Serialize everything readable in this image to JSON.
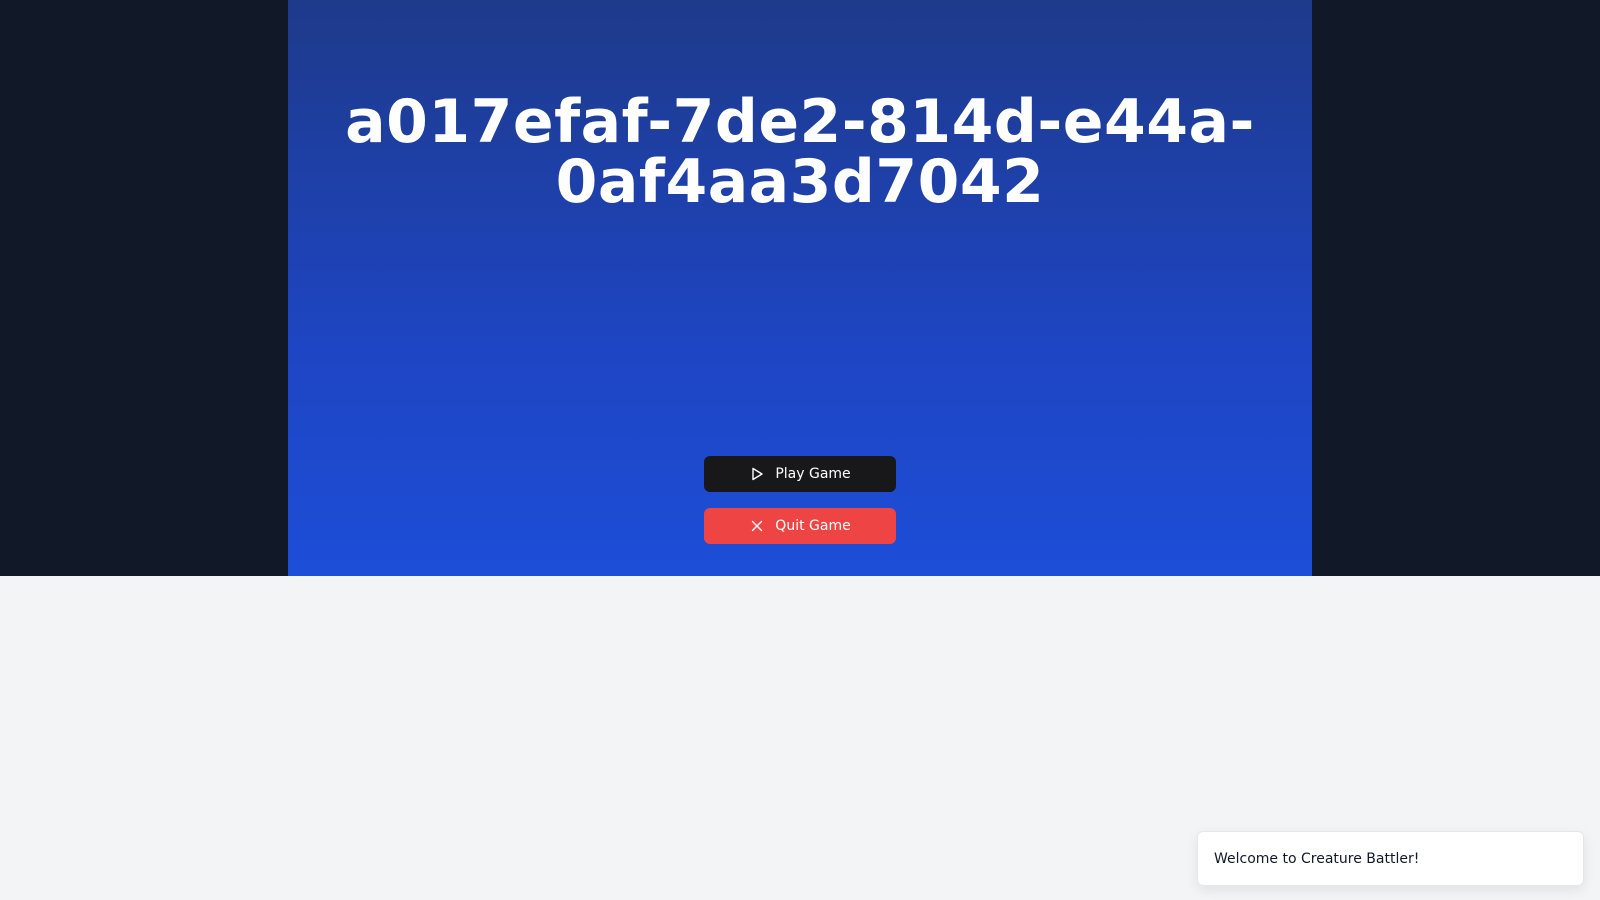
{
  "game": {
    "title": "a017efaf-7de2-814d-e44a-0af4aa3d7042"
  },
  "menu": {
    "play_label": "Play Game",
    "play_icon": "play-icon",
    "quit_label": "Quit Game",
    "quit_icon": "close-icon"
  },
  "toast": {
    "message": "Welcome to Creature Battler!"
  },
  "colors": {
    "background_dark": "#111827",
    "panel_blue": "#1d4ed8",
    "play_button": "#18181b",
    "quit_button": "#ef4444",
    "page_background": "#f3f4f6"
  }
}
